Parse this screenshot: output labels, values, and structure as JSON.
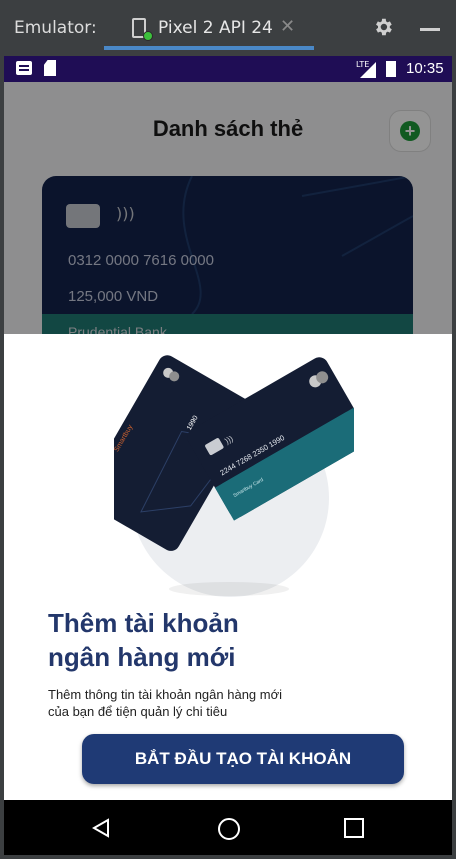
{
  "emulator": {
    "title": "Emulator:",
    "tab_label": "Pixel 2 API 24",
    "tab_close": "✕",
    "icons": [
      "device-icon",
      "settings-gear-icon",
      "minimize-icon"
    ]
  },
  "statusbar": {
    "time": "10:35",
    "network": "LTE"
  },
  "app": {
    "title": "Danh sách thẻ",
    "add_icon": "+",
    "card": {
      "number": "0312 0000 7616 0000",
      "balance": "125,000 VND",
      "bank": "Prudential Bank"
    }
  },
  "sheet": {
    "title_line1": "Thêm tài khoản",
    "title_line2": "ngân hàng mới",
    "desc_line1": "Thêm thông tin tài khoản ngân hàng mới",
    "desc_line2": "của bạn để tiện quản lý chi tiêu",
    "cta_label": "BẮT ĐẦU TẠO TÀI KHOẢN",
    "illustration": {
      "front_card_number": "2244 7268 2350 1990",
      "front_card_label": "Smartbuy Card",
      "back_card_brand": "Smartbuy",
      "back_card_number": "1990"
    }
  },
  "colors": {
    "primary": "#1f3a75",
    "title": "#23376b",
    "statusbar": "#1f0d55",
    "add_green": "#1e9b3a"
  }
}
